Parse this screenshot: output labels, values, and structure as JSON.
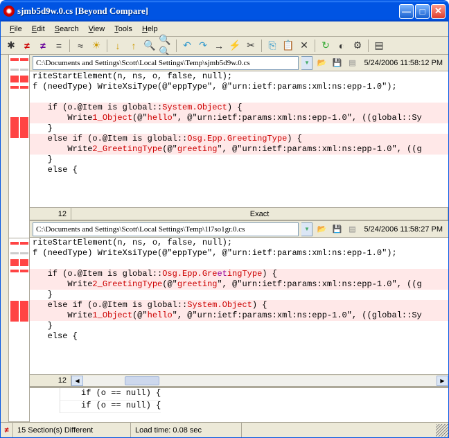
{
  "title": "sjmb5d9w.0.cs  [Beyond Compare]",
  "menu": {
    "file": "File",
    "edit": "Edit",
    "search": "Search",
    "view": "View",
    "tools": "Tools",
    "help": "Help"
  },
  "pane1": {
    "path": "C:\\Documents and Settings\\Scott\\Local Settings\\Temp\\sjmb5d9w.0.cs",
    "timestamp": "5/24/2006  11:58:12 PM",
    "line_no": "12",
    "status_text": "Exact"
  },
  "pane2": {
    "path": "C:\\Documents and Settings\\Scott\\Local Settings\\Temp\\1l7so1gr.0.cs",
    "timestamp": "5/24/2006  11:58:27 PM",
    "line_no": "12"
  },
  "code1": {
    "l1": "riteStartElement(n, ns, o, false, null);",
    "l2": "f (needType) WriteXsiType(@\"eppType\", @\"urn:ietf:params:xml:ns:epp-1.0\");",
    "l3": "",
    "l4a": "   if (o.@Item is global::",
    "l4b": "System.Object",
    "l4c": ") {",
    "l5a": "       Write",
    "l5b": "1_Object",
    "l5c": "(@\"",
    "l5d": "hello",
    "l5e": "\", @\"urn:ietf:params:xml:ns:epp-1.0\", ((global::Sy",
    "l6": "   }",
    "l7a": "   else if (o.@Item is global::",
    "l7b": "Osg.Epp.GreetingType",
    "l7c": ") {",
    "l8a": "       Write",
    "l8b": "2_GreetingType",
    "l8c": "(@\"",
    "l8d": "greeting",
    "l8e": "\", @\"urn:ietf:params:xml:ns:epp-1.0\", ((g",
    "l9": "   }",
    "l10": "   else {"
  },
  "code2": {
    "l1": "riteStartElement(n, ns, o, false, null);",
    "l2": "f (needType) WriteXsiType(@\"eppType\", @\"urn:ietf:params:xml:ns:epp-1.0\");",
    "l3": "",
    "l4a": "   if (o.@Item is global::",
    "l4b": "Osg.Epp.Gre",
    "l4b2": "et",
    "l4b3": "ingType",
    "l4c": ") {",
    "l5a": "       Write",
    "l5b": "2_GreetingType",
    "l5c": "(@\"",
    "l5d": "greeting",
    "l5e": "\", @\"urn:ietf:params:xml:ns:epp-1.0\", ((g",
    "l6": "   }",
    "l7a": "   else if (o.@Item is global::",
    "l7b": "System.Object",
    "l7c": ") {",
    "l8a": "       Write",
    "l8b": "1_Object",
    "l8c": "(@\"",
    "l8d": "hello",
    "l8e": "\", @\"urn:ietf:params:xml:ns:epp-1.0\", ((global::Sy",
    "l9": "   }",
    "l10": "   else {"
  },
  "bottom": {
    "l1": "if (o == null) {",
    "l2": "if (o == null) {"
  },
  "status": {
    "sections": "15 Section(s) Different",
    "load": "Load time:  0.08 sec"
  }
}
